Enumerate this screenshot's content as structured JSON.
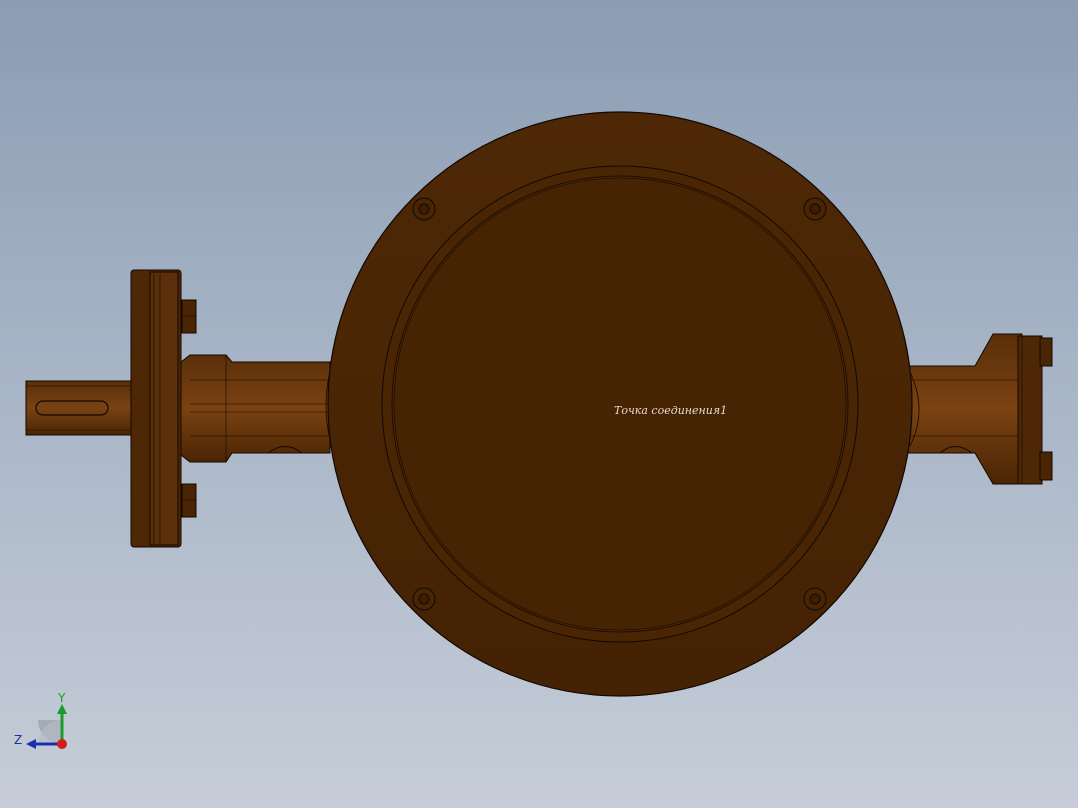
{
  "viewport": {
    "background_top": "#8b9cb3",
    "background_bottom": "#c6cdd8"
  },
  "model": {
    "part_color": "#4a2504",
    "edge_color": "#120800",
    "annotation_text": "Точка соединения1"
  },
  "triad": {
    "y_label": "Y",
    "z_label": "Z",
    "y_color": "#1a9c2a",
    "z_color": "#1b2fb0",
    "x_color": "#d21c1c"
  }
}
